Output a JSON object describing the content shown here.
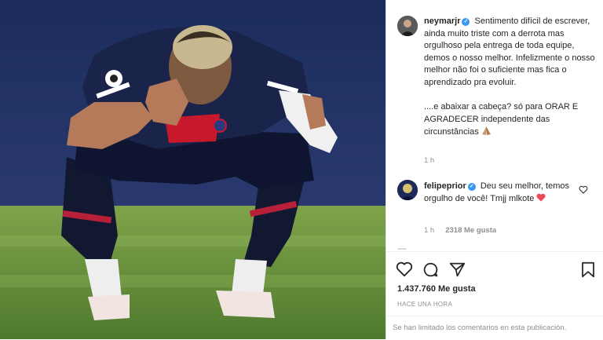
{
  "post": {
    "author": {
      "username": "neymarjr",
      "verified_mark": "✓",
      "caption_p1": "Sentimento difícil de escrever, ainda muito triste com a derrota mas orgulhoso pela entrega de toda equipe, demos o nosso melhor. Infelizmente o nosso melhor não foi o suficiente mas fica o aprendizado pra evoluir.",
      "caption_p2": "....e abaixar a cabeça? só para ORAR E AGRADECER independente das circunstâncias",
      "caption_emoji": "praying-hands-icon",
      "time": "1 h"
    },
    "comments": [
      {
        "username": "felipeprior",
        "verified_mark": "✓",
        "text": "Deu seu melhor, temos orgulho de você! Tmjj mlkote",
        "emoji": "red-heart-icon",
        "time": "1 h",
        "likes": "2318 Me gusta"
      }
    ],
    "likes": "1.437.760 Me gusta",
    "posted_ago": "HACE UNA HORA",
    "comments_limited": "Se han limitado los comentarios en esta publicación."
  },
  "icons": [
    "heart-icon",
    "comment-icon",
    "share-icon",
    "bookmark-icon",
    "like-comment-heart-icon"
  ],
  "colors": {
    "verified": "#3897f0",
    "text": "#262626",
    "secondary": "#8e8e8e",
    "heart_emoji": "#ed4956"
  }
}
